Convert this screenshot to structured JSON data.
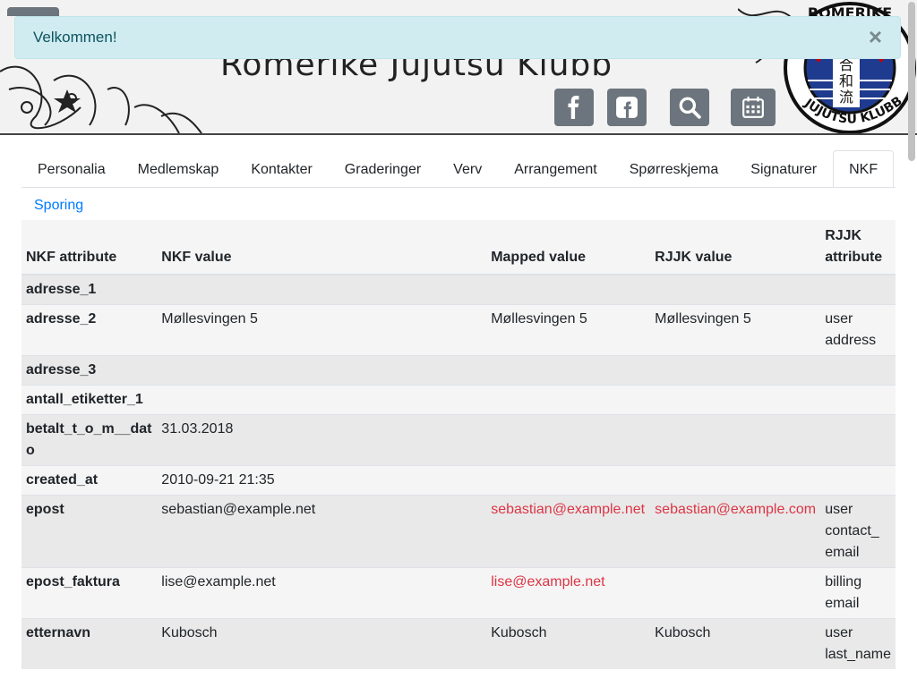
{
  "alert": {
    "message": "Velkommen!",
    "close_label": "×"
  },
  "header": {
    "title": "Romerike Jujutsu Klubb",
    "logo": {
      "text_top": "ROMERIKE",
      "text_bottom": "JUJUTSU KLUBB",
      "kanji": [
        "合",
        "和",
        "流"
      ]
    },
    "buttons": [
      {
        "name": "facebook-button",
        "icon": "facebook-icon"
      },
      {
        "name": "facebook-group-button",
        "icon": "facebook-square-icon"
      },
      {
        "name": "search-button",
        "icon": "search-icon"
      },
      {
        "name": "calendar-button",
        "icon": "calendar-icon"
      }
    ]
  },
  "tabs": {
    "row1": [
      "Personalia",
      "Medlemskap",
      "Kontakter",
      "Graderinger",
      "Verv",
      "Arrangement",
      "Spørreskjema",
      "Signaturer",
      "NKF"
    ],
    "active": "NKF",
    "row2": [
      "Sporing"
    ]
  },
  "table": {
    "headers": [
      "NKF attribute",
      "NKF value",
      "Mapped value",
      "RJJK value",
      "RJJK attribute"
    ],
    "rows": [
      {
        "attr": "adresse_1",
        "nkf": "",
        "mapped": "",
        "rjjk": "",
        "rjjk_attr": ""
      },
      {
        "attr": "adresse_2",
        "nkf": "Møllesvingen 5",
        "mapped": "Møllesvingen 5",
        "rjjk": "Møllesvingen 5",
        "rjjk_attr": "user address"
      },
      {
        "attr": "adresse_3",
        "nkf": "",
        "mapped": "",
        "rjjk": "",
        "rjjk_attr": ""
      },
      {
        "attr": "antall_etiketter_1",
        "nkf": "",
        "mapped": "",
        "rjjk": "",
        "rjjk_attr": ""
      },
      {
        "attr": "betalt_t_o_m__dato",
        "nkf": "31.03.2018",
        "mapped": "",
        "rjjk": "",
        "rjjk_attr": ""
      },
      {
        "attr": "created_at",
        "nkf": "2010-09-21 21:35",
        "mapped": "",
        "rjjk": "",
        "rjjk_attr": ""
      },
      {
        "attr": "epost",
        "nkf": "sebastian@example.net",
        "mapped": "sebastian@example.net",
        "rjjk": "sebastian@example.com",
        "rjjk_attr": "user contact_ email",
        "diff": true
      },
      {
        "attr": "epost_faktura",
        "nkf": "lise@example.net",
        "mapped": "lise@example.net",
        "rjjk": "",
        "rjjk_attr": "billing email",
        "diff": true
      },
      {
        "attr": "etternavn",
        "nkf": "Kubosch",
        "mapped": "Kubosch",
        "rjjk": "Kubosch",
        "rjjk_attr": "user last_name"
      }
    ]
  },
  "colors": {
    "accent": "#007bff",
    "diff": "#dc3545",
    "alert_bg": "#d1ecf1",
    "button": "#6c757d"
  }
}
